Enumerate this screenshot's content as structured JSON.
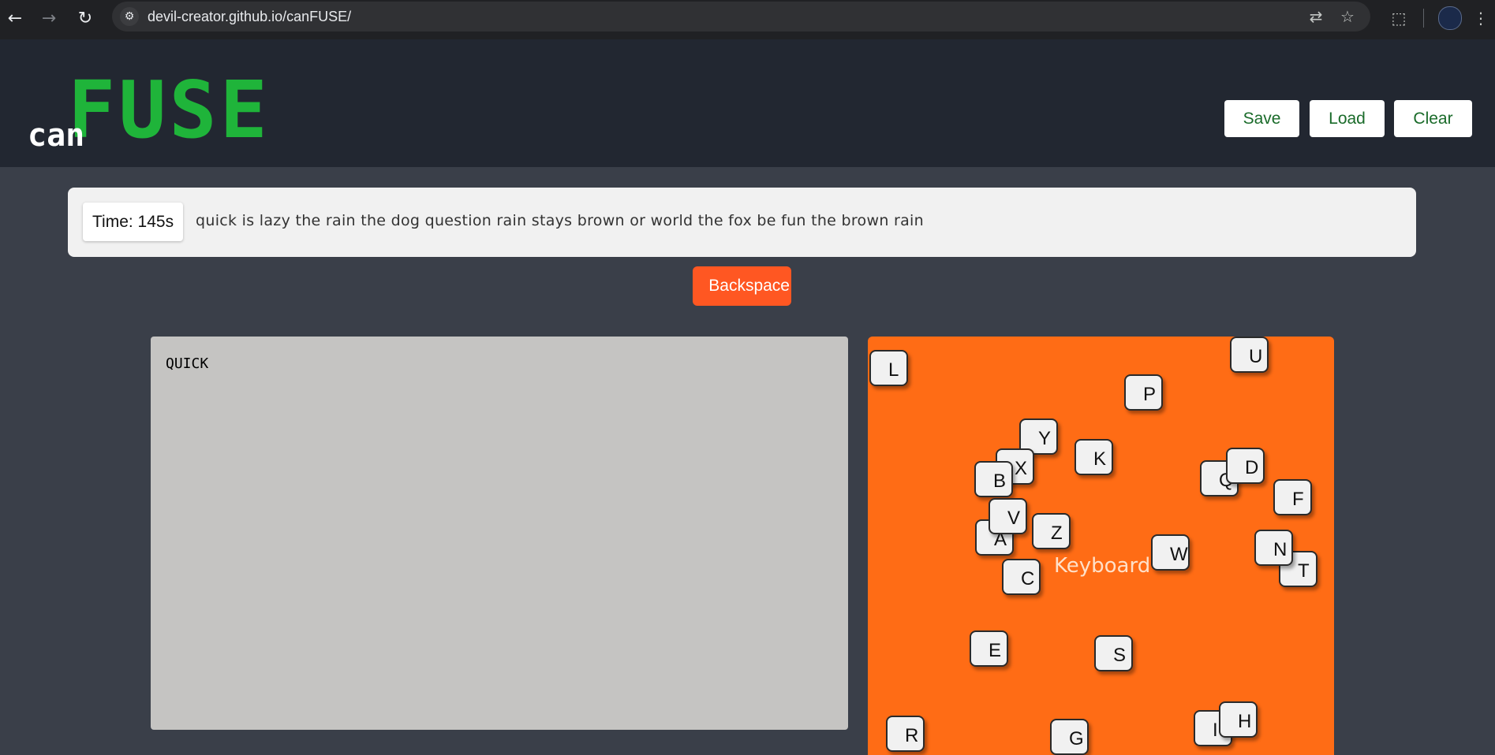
{
  "browser": {
    "url": "devil-creator.github.io/canFUSE/",
    "icons": {
      "back": "back-arrow-icon",
      "forward": "forward-arrow-icon",
      "reload": "reload-icon",
      "site_info": "site-info-icon",
      "translate": "translate-icon",
      "bookmark": "star-icon",
      "extensions": "puzzle-icon",
      "menu": "kebab-menu-icon"
    }
  },
  "header": {
    "logo_small": "can",
    "logo_large": "FUSE",
    "buttons": {
      "save": "Save",
      "load": "Load",
      "clear": "Clear"
    }
  },
  "game": {
    "timer": "Time: 145s",
    "sentence": "quick is lazy the rain the dog question rain stays brown or world the fox be fun the brown rain",
    "backspace_label": "Backspace",
    "typed_text": "QUICK"
  },
  "keyboard": {
    "label": "Keyboard",
    "keys": [
      "L",
      "U",
      "P",
      "Y",
      "K",
      "X",
      "B",
      "Q",
      "D",
      "F",
      "V",
      "A",
      "Z",
      "N",
      "T",
      "W",
      "C",
      "E",
      "S",
      "R",
      "G",
      "I",
      "H"
    ]
  },
  "colors": {
    "brand_green": "#1fb43a",
    "keyboard_bg": "#ff6c15",
    "backspace_bg": "#ff5722",
    "header_bg": "#222731",
    "page_bg": "#3a3f49"
  }
}
